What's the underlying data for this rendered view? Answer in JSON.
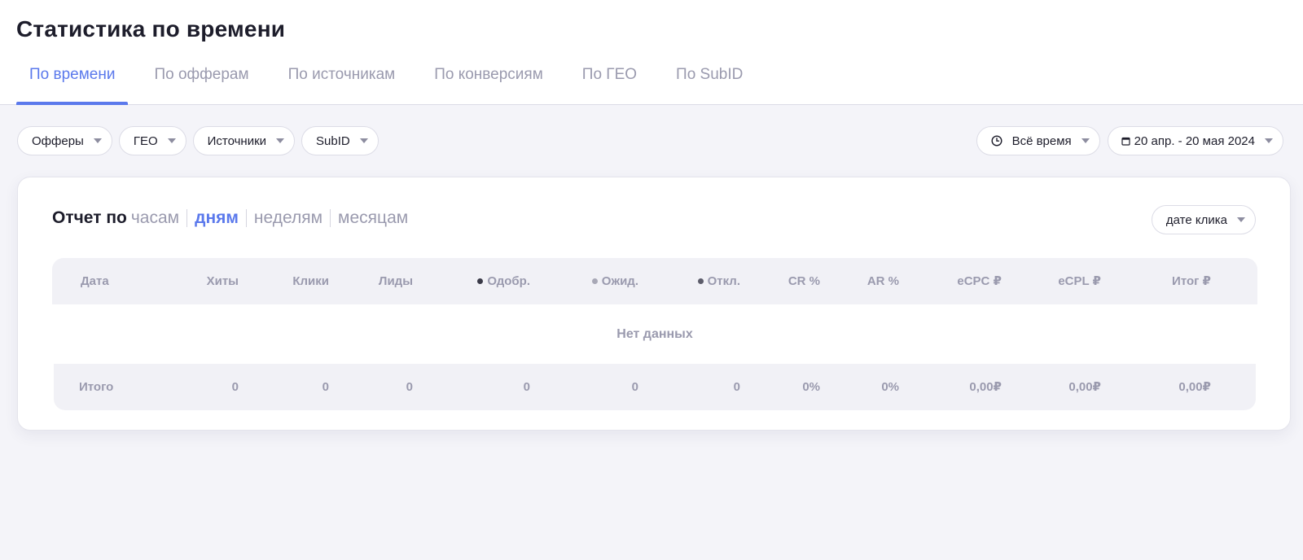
{
  "page": {
    "title": "Статистика по времени"
  },
  "tabs": [
    {
      "label": "По времени",
      "active": true
    },
    {
      "label": "По офферам",
      "active": false
    },
    {
      "label": "По источникам",
      "active": false
    },
    {
      "label": "По конверсиям",
      "active": false
    },
    {
      "label": "По ГЕО",
      "active": false
    },
    {
      "label": "По SubID",
      "active": false
    }
  ],
  "filters": {
    "offers": "Офферы",
    "geo": "ГЕО",
    "sources": "Источники",
    "subid": "SubID",
    "period": "Всё время",
    "date_range": "20 апр. - 20 мая 2024"
  },
  "report": {
    "prefix": "Отчет по",
    "periods": [
      "часам",
      "дням",
      "неделям",
      "месяцам"
    ],
    "active_period": "дням",
    "date_basis": "дате клика"
  },
  "table": {
    "columns": [
      "Дата",
      "Хиты",
      "Клики",
      "Лиды",
      "Одобр.",
      "Ожид.",
      "Откл.",
      "CR %",
      "AR %",
      "eCPC ₽",
      "eCPL ₽",
      "Итог ₽"
    ],
    "status_colors": {
      "approved": "#3a3a48",
      "pending": "#a8a8b6",
      "rejected": "#5c5c6a"
    },
    "empty_text": "Нет данных",
    "totals": [
      "Итого",
      "0",
      "0",
      "0",
      "0",
      "0",
      "0",
      "0%",
      "0%",
      "0,00₽",
      "0,00₽",
      "0,00₽"
    ]
  },
  "colors": {
    "accent": "#5b79ec",
    "muted": "#9a9aae",
    "background": "#f4f4f9"
  }
}
